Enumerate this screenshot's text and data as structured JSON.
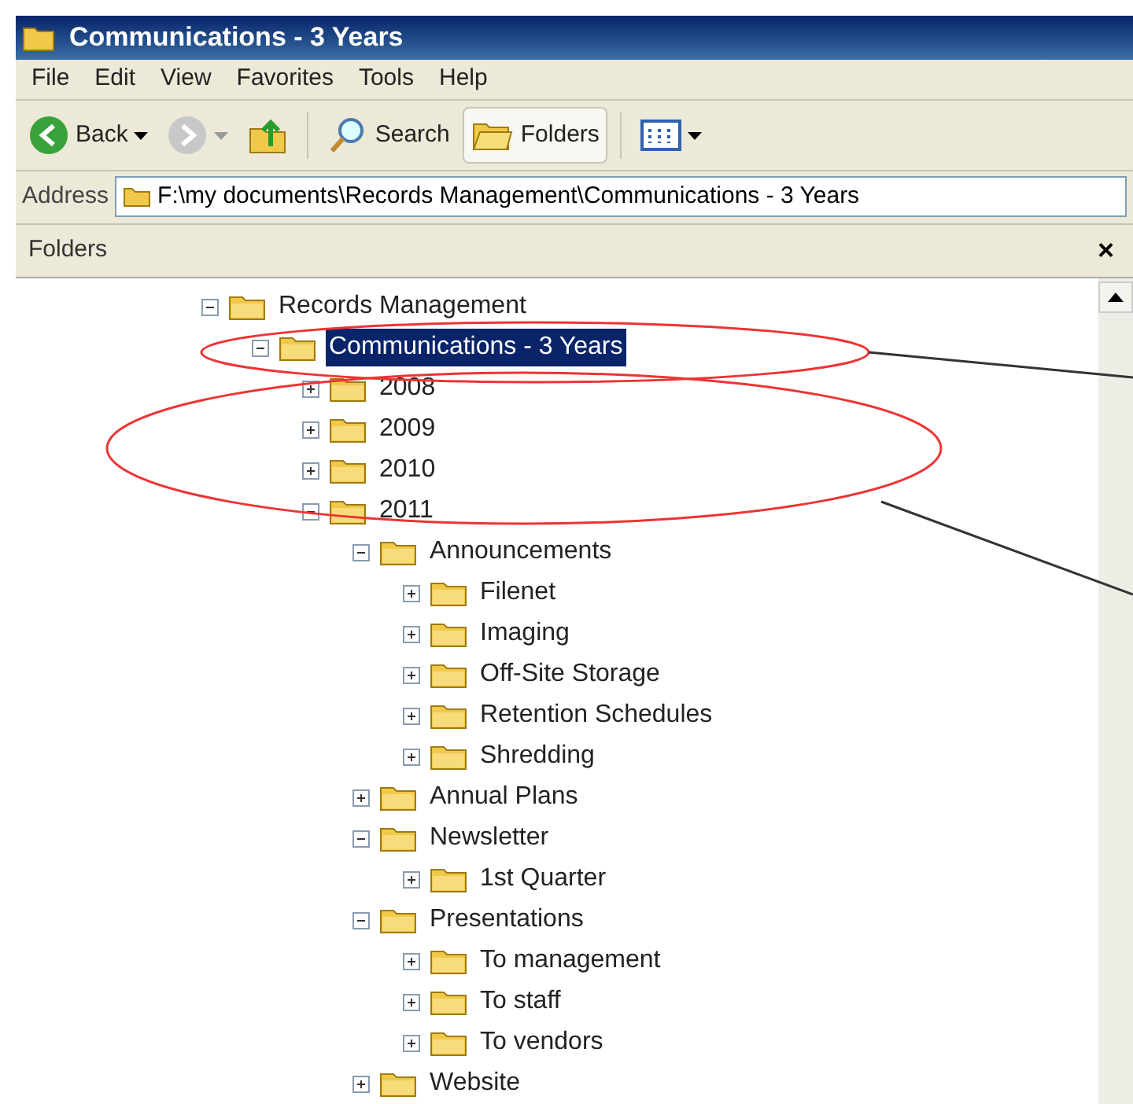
{
  "window": {
    "title": "Communications - 3 Years"
  },
  "menu": [
    "File",
    "Edit",
    "View",
    "Favorites",
    "Tools",
    "Help"
  ],
  "toolbar": [
    {
      "kind": "back",
      "label": "Back"
    },
    {
      "kind": "forward"
    },
    {
      "kind": "up"
    },
    {
      "kind": "search",
      "label": "Search"
    },
    {
      "kind": "folders",
      "label": "Folders",
      "selected": true
    },
    {
      "kind": "views"
    }
  ],
  "address": {
    "label": "Address",
    "value": "F:\\my documents\\Records Management\\Communications - 3 Years"
  },
  "pane": {
    "title": "Folders",
    "close": "×"
  },
  "tree": [
    {
      "label": "Records Management",
      "expanded": true,
      "selected": false,
      "children": [
        {
          "label": "Communications - 3 Years",
          "expanded": true,
          "selected": true,
          "children": [
            {
              "label": "2008",
              "expanded": false,
              "selected": false
            },
            {
              "label": "2009",
              "expanded": false,
              "selected": false
            },
            {
              "label": "2010",
              "expanded": false,
              "selected": false
            },
            {
              "label": "2011",
              "expanded": true,
              "selected": false,
              "children": [
                {
                  "label": "Announcements",
                  "expanded": true,
                  "selected": false,
                  "children": [
                    {
                      "label": "Filenet",
                      "expanded": false,
                      "selected": false
                    },
                    {
                      "label": "Imaging",
                      "expanded": false,
                      "selected": false
                    },
                    {
                      "label": "Off-Site Storage",
                      "expanded": false,
                      "selected": false
                    },
                    {
                      "label": "Retention Schedules",
                      "expanded": false,
                      "selected": false
                    },
                    {
                      "label": "Shredding",
                      "expanded": false,
                      "selected": false
                    }
                  ]
                },
                {
                  "label": "Annual Plans",
                  "expanded": false,
                  "selected": false
                },
                {
                  "label": "Newsletter",
                  "expanded": true,
                  "selected": false,
                  "children": [
                    {
                      "label": "1st Quarter",
                      "expanded": false,
                      "selected": false
                    }
                  ]
                },
                {
                  "label": "Presentations",
                  "expanded": true,
                  "selected": false,
                  "children": [
                    {
                      "label": "To management",
                      "expanded": false,
                      "selected": false
                    },
                    {
                      "label": "To staff",
                      "expanded": false,
                      "selected": false
                    },
                    {
                      "label": "To vendors",
                      "expanded": false,
                      "selected": false
                    }
                  ]
                },
                {
                  "label": "Website",
                  "expanded": false,
                  "selected": false
                }
              ]
            }
          ]
        }
      ]
    }
  ]
}
